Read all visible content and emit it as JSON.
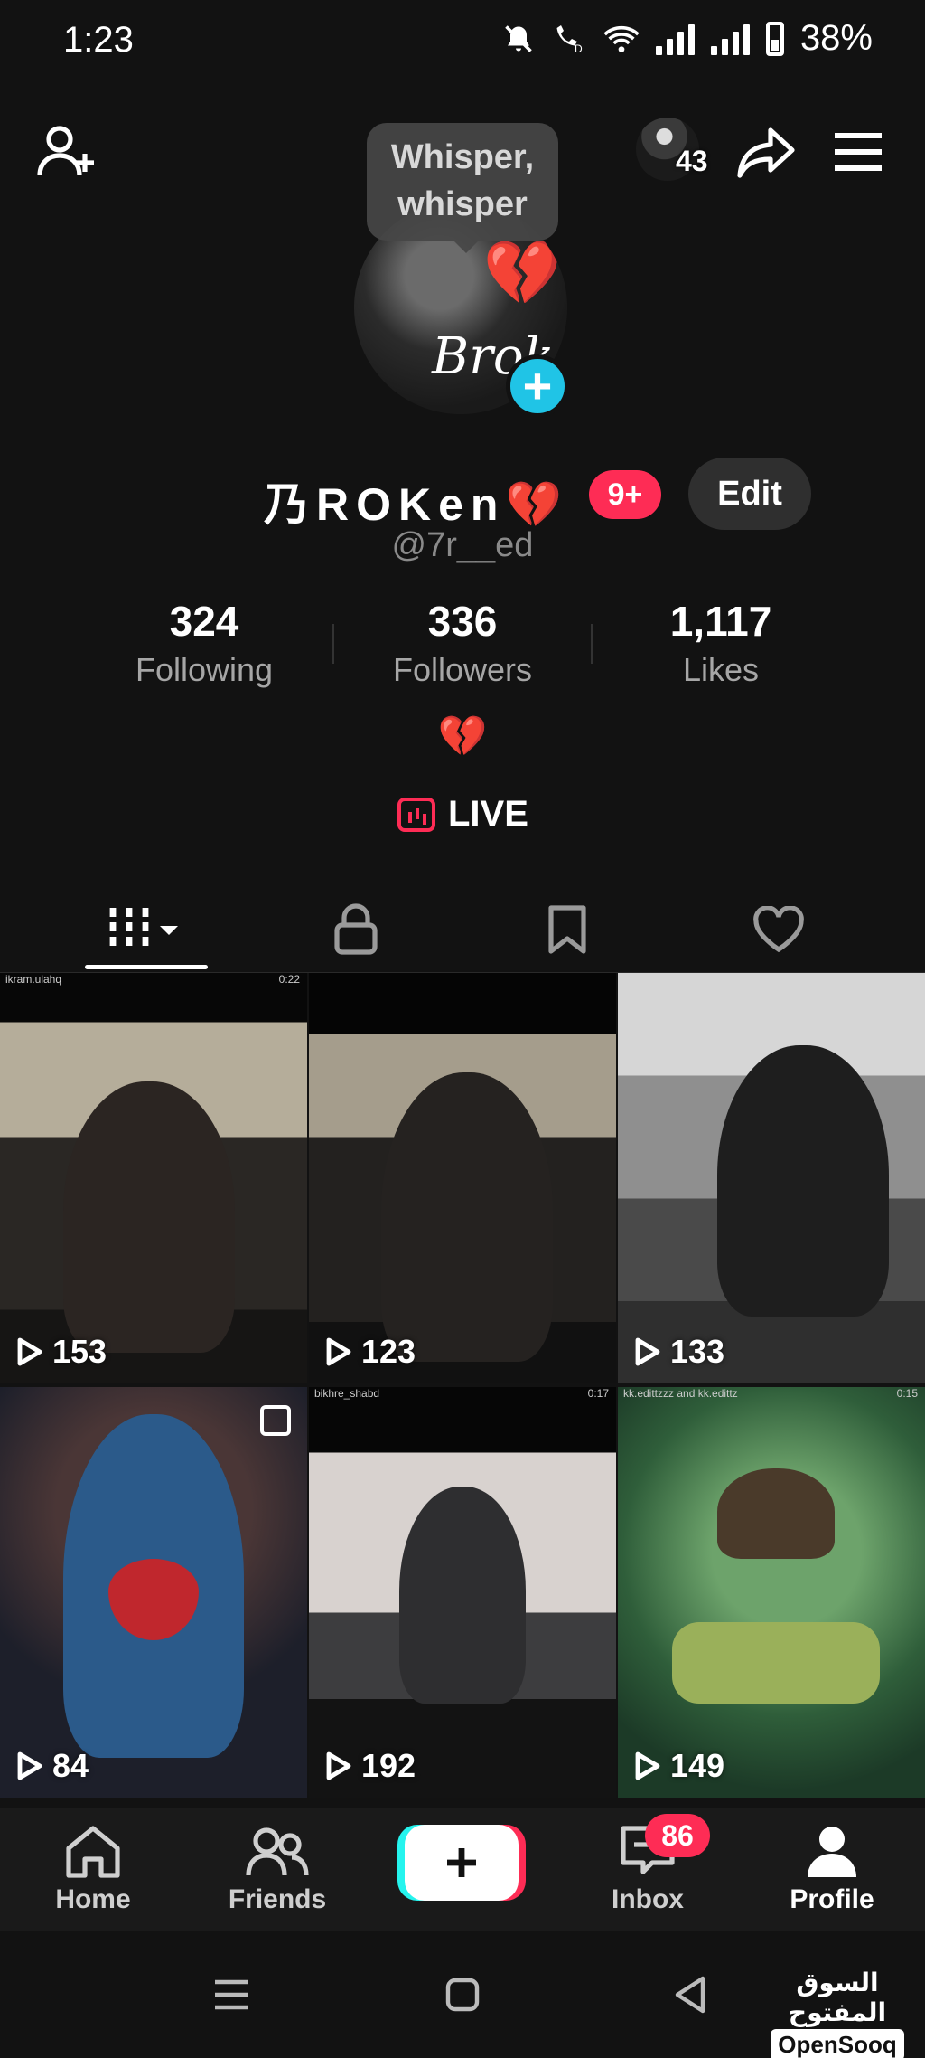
{
  "status_bar": {
    "time": "1:23",
    "battery": "38%"
  },
  "header": {
    "mini_avatar_count": "43",
    "tooltip": "Whisper, whisper"
  },
  "profile": {
    "display_name": "乃ROKen💔",
    "notification_badge": "9+",
    "edit_label": "Edit",
    "handle": "@7r__ed",
    "bio": "💔",
    "live_label": "LIVE",
    "stats": [
      {
        "value": "324",
        "label": "Following"
      },
      {
        "value": "336",
        "label": "Followers"
      },
      {
        "value": "1,117",
        "label": "Likes"
      }
    ]
  },
  "tabs": [
    "videos",
    "private",
    "saved",
    "liked"
  ],
  "videos": [
    {
      "views": "153",
      "caption": "ikram.ulahq",
      "duration": "0:22"
    },
    {
      "views": "123",
      "caption": "",
      "duration": ""
    },
    {
      "views": "133",
      "caption": "",
      "duration": ""
    },
    {
      "views": "84",
      "caption": "",
      "duration": ""
    },
    {
      "views": "192",
      "caption": "bikhre_shabd",
      "duration": "0:17"
    },
    {
      "views": "149",
      "caption": "kk.edittzzz and kk.edittz",
      "duration": "0:15"
    }
  ],
  "nav": {
    "home": "Home",
    "friends": "Friends",
    "inbox": "Inbox",
    "inbox_badge": "86",
    "profile": "Profile"
  },
  "watermark": {
    "arabic": "السوق المفتوح",
    "latin": "OpenSooq"
  },
  "colors": {
    "accent": "#fe2c55",
    "cyan": "#25f4ee",
    "background": "#121212"
  }
}
